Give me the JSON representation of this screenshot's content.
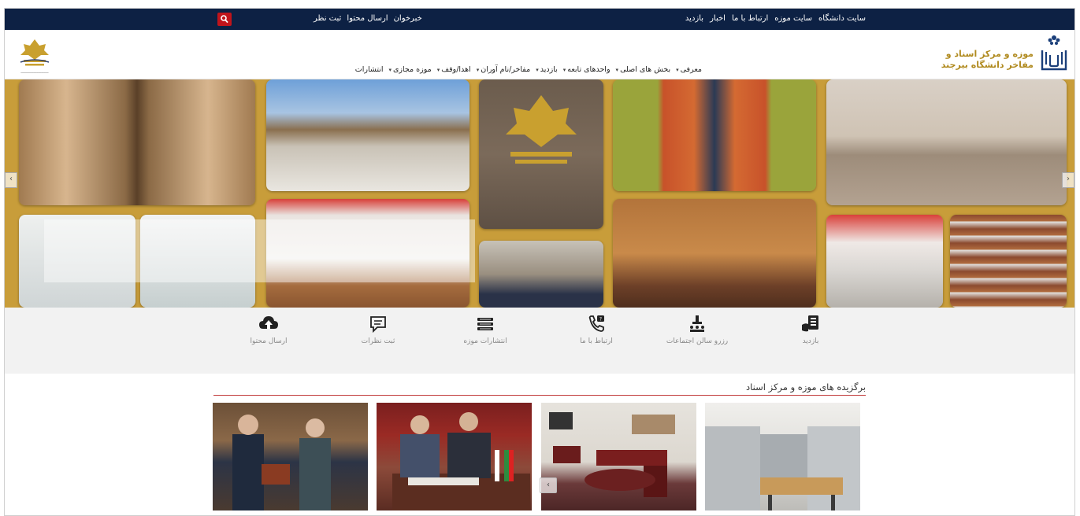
{
  "topbar": {
    "right_links": [
      "سایت دانشگاه",
      "سایت موزه",
      "ارتباط با ما",
      "اخبار",
      "بازدید"
    ],
    "left_links": [
      "خبرخوان",
      "ارسال محتوا",
      "ثبت نظر"
    ],
    "search_icon": "search-icon"
  },
  "header": {
    "brand_line1": "موزه و مرکز اسناد و",
    "brand_line2": "مفاخر دانشگاه بیرجند",
    "nav": [
      "معرفی",
      "بخش های اصلی",
      "واحدهای تابعه",
      "بازدید",
      "مفاخر/نام آوران",
      "اهدا/وقف",
      "موزه مجازی",
      "انتشارات"
    ],
    "nav_has_caret": [
      true,
      true,
      true,
      true,
      true,
      true,
      true,
      false
    ]
  },
  "slider": {
    "prev_label": "‹",
    "next_label": "›"
  },
  "quick_links": [
    {
      "label": "بازدید",
      "icon": "visit-card-icon"
    },
    {
      "label": "رزرو سالن اجتماعات",
      "icon": "hall-reserve-icon"
    },
    {
      "label": "ارتباط با ما",
      "icon": "phone-contact-icon"
    },
    {
      "label": "انتشارات موزه",
      "icon": "books-stack-icon"
    },
    {
      "label": "ثبت نظرات",
      "icon": "comment-icon"
    },
    {
      "label": "ارسال محتوا",
      "icon": "cloud-upload-icon"
    }
  ],
  "featured": {
    "title": "برگزیده های موزه و مرکز اسناد",
    "arrow_label": "‹"
  },
  "colors": {
    "topbar_bg": "#0d2144",
    "accent_red": "#c0141b",
    "brand_gold": "#b08a1e",
    "slider_bg": "#c89d3a"
  }
}
